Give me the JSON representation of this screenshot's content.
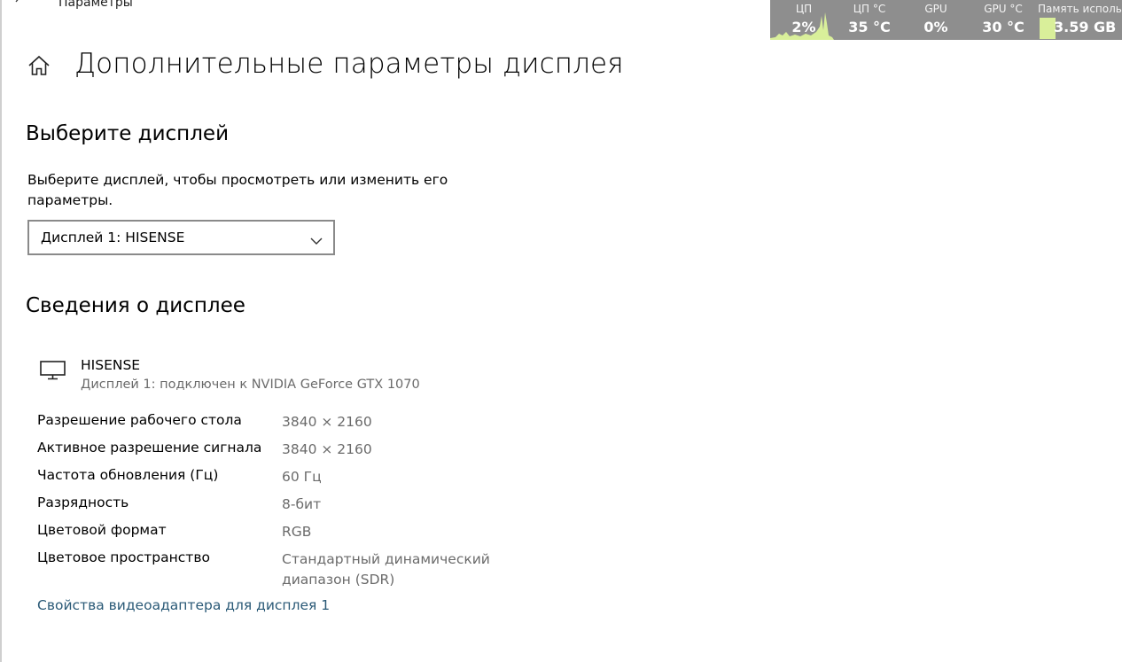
{
  "window": {
    "title": "Параметры"
  },
  "page": {
    "title": "Дополнительные параметры дисплея"
  },
  "select_section": {
    "heading": "Выберите дисплей",
    "description": "Выберите дисплей, чтобы просмотреть или изменить его параметры.",
    "dropdown_value": "Дисплей 1: HISENSE"
  },
  "info_section": {
    "heading": "Сведения о дисплее",
    "display_name": "HISENSE",
    "display_connection": "Дисплей 1: подключен к NVIDIA GeForce GTX 1070",
    "rows": [
      {
        "label": "Разрешение рабочего стола",
        "value": "3840 × 2160"
      },
      {
        "label": "Активное разрешение сигнала",
        "value": "3840 × 2160"
      },
      {
        "label": "Частота обновления (Гц)",
        "value": "60 Гц"
      },
      {
        "label": "Разрядность",
        "value": "8-бит"
      },
      {
        "label": "Цветовой формат",
        "value": "RGB"
      },
      {
        "label": "Цветовое пространство",
        "value": "Стандартный динамический диапазон (SDR)"
      }
    ],
    "adapter_link": "Свойства видеоадаптера для дисплея 1"
  },
  "system_monitor": {
    "cpu_label": "ЦП",
    "cpu_value": "2%",
    "cpu_temp_label": "ЦП °C",
    "cpu_temp_value": "35 °C",
    "gpu_label": "GPU",
    "gpu_value": "0%",
    "gpu_temp_label": "GPU °C",
    "gpu_temp_value": "30 °C",
    "mem_label": "Память использ",
    "mem_value": "3.59 GB"
  },
  "colors": {
    "link": "#2b5a77",
    "secondary_text": "#6b6b6b",
    "monitor_bg": "#8e8e8e",
    "monitor_graph": "#d9ef9a"
  },
  "icons": [
    "back-arrow-icon",
    "home-icon",
    "chevron-down-icon",
    "monitor-icon"
  ]
}
